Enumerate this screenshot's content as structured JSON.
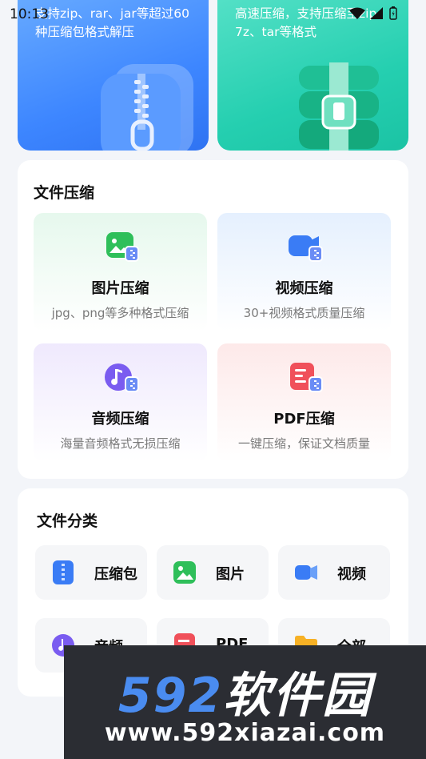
{
  "status_bar": {
    "time": "10:13"
  },
  "top_cards": [
    {
      "desc": "支持zip、rar、jar等超过60种压缩包格式解压"
    },
    {
      "desc": "高速压缩，支持压缩至zip、7z、tar等格式"
    }
  ],
  "compress_section": {
    "title": "文件压缩",
    "tiles": [
      {
        "title": "图片压缩",
        "sub": "jpg、png等多种格式压缩"
      },
      {
        "title": "视频压缩",
        "sub": "30+视频格式质量压缩"
      },
      {
        "title": "音频压缩",
        "sub": "海量音频格式无损压缩"
      },
      {
        "title": "PDF压缩",
        "sub": "一键压缩，保证文档质量"
      }
    ]
  },
  "category_section": {
    "title": "文件分类",
    "items": [
      {
        "label": "压缩包"
      },
      {
        "label": "图片"
      },
      {
        "label": "视频"
      },
      {
        "label": "音频"
      },
      {
        "label": "PDF"
      },
      {
        "label": "全部"
      }
    ]
  },
  "watermark": {
    "brand_num": "592",
    "brand_cn": "软件园",
    "url": "www.592xiazai.com"
  },
  "colors": {
    "blue": "#3d86ff",
    "teal": "#25cfb0",
    "green": "#2fbf5a",
    "purple": "#7a5cf0",
    "red": "#f0505a",
    "orange": "#f7b125"
  }
}
